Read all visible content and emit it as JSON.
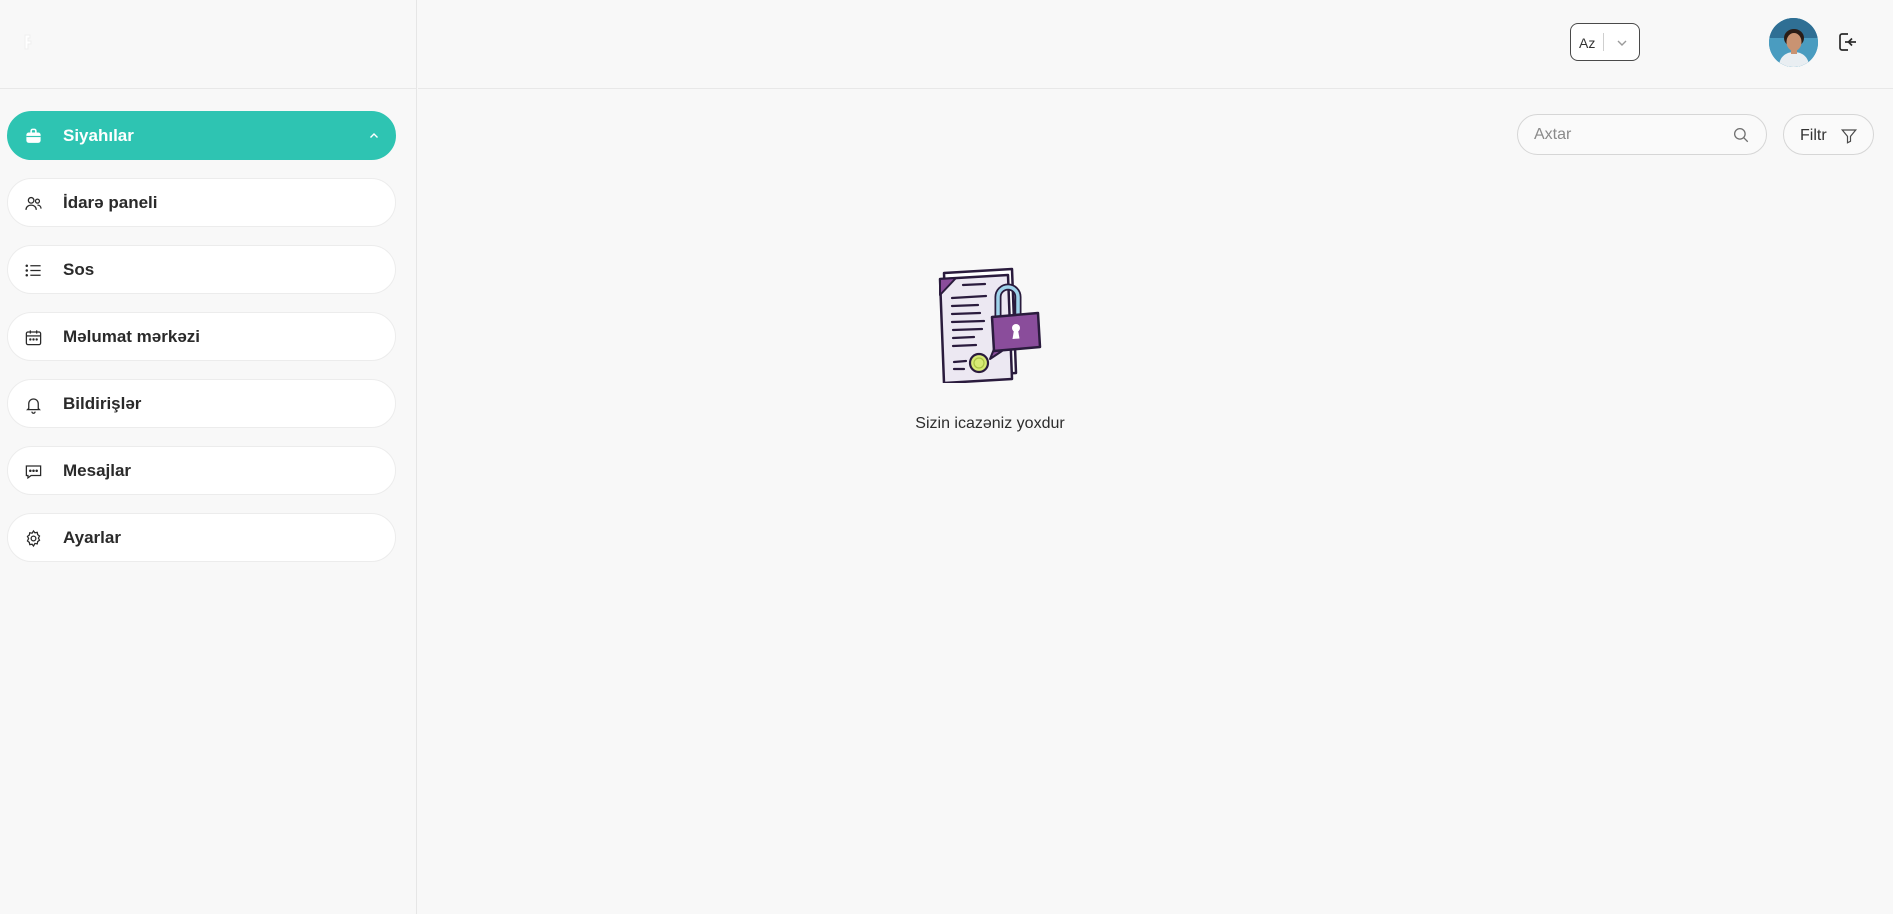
{
  "sidebar": {
    "items": [
      {
        "label": "Siyahılar",
        "icon": "briefcase-icon",
        "active": true
      },
      {
        "label": "İdarə paneli",
        "icon": "users-icon",
        "active": false
      },
      {
        "label": "Sos",
        "icon": "list-icon",
        "active": false
      },
      {
        "label": "Məlumat mərkəzi",
        "icon": "calendar-icon",
        "active": false
      },
      {
        "label": "Bildirişlər",
        "icon": "bell-icon",
        "active": false
      },
      {
        "label": "Mesajlar",
        "icon": "message-icon",
        "active": false
      },
      {
        "label": "Ayarlar",
        "icon": "gear-icon",
        "active": false
      }
    ]
  },
  "header": {
    "language": "Az"
  },
  "toolbar": {
    "search_placeholder": "Axtar",
    "filter_label": "Filtr"
  },
  "empty_state": {
    "message": "Sizin icazəniz yoxdur"
  },
  "colors": {
    "accent": "#2ec4b2",
    "background": "#f8f8f8"
  }
}
